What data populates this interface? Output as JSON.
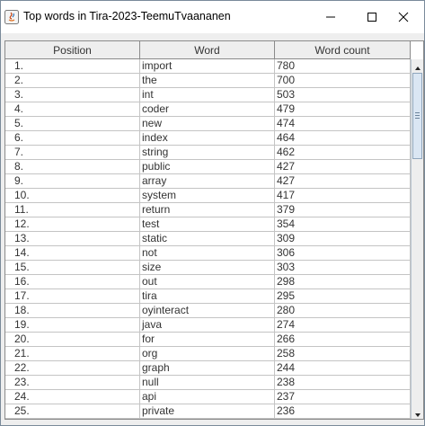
{
  "window": {
    "title": "Top words in Tira-2023-TeemuTvaananen",
    "icon": "java-app-icon",
    "controls": [
      "minimize-icon",
      "maximize-icon",
      "close-icon"
    ]
  },
  "table": {
    "columns": [
      "Position",
      "Word",
      "Word count"
    ],
    "rows": [
      {
        "position": "1.",
        "word": "import",
        "count": "780"
      },
      {
        "position": "2.",
        "word": "the",
        "count": "700"
      },
      {
        "position": "3.",
        "word": "int",
        "count": "503"
      },
      {
        "position": "4.",
        "word": "coder",
        "count": "479"
      },
      {
        "position": "5.",
        "word": "new",
        "count": "474"
      },
      {
        "position": "6.",
        "word": "index",
        "count": "464"
      },
      {
        "position": "7.",
        "word": "string",
        "count": "462"
      },
      {
        "position": "8.",
        "word": "public",
        "count": "427"
      },
      {
        "position": "9.",
        "word": "array",
        "count": "427"
      },
      {
        "position": "10.",
        "word": "system",
        "count": "417"
      },
      {
        "position": "11.",
        "word": "return",
        "count": "379"
      },
      {
        "position": "12.",
        "word": "test",
        "count": "354"
      },
      {
        "position": "13.",
        "word": "static",
        "count": "309"
      },
      {
        "position": "14.",
        "word": "not",
        "count": "306"
      },
      {
        "position": "15.",
        "word": "size",
        "count": "303"
      },
      {
        "position": "16.",
        "word": "out",
        "count": "298"
      },
      {
        "position": "17.",
        "word": "tira",
        "count": "295"
      },
      {
        "position": "18.",
        "word": "oyinteract",
        "count": "280"
      },
      {
        "position": "19.",
        "word": "java",
        "count": "274"
      },
      {
        "position": "20.",
        "word": "for",
        "count": "266"
      },
      {
        "position": "21.",
        "word": "org",
        "count": "258"
      },
      {
        "position": "22.",
        "word": "graph",
        "count": "244"
      },
      {
        "position": "23.",
        "word": "null",
        "count": "238"
      },
      {
        "position": "24.",
        "word": "api",
        "count": "237"
      },
      {
        "position": "25.",
        "word": "private",
        "count": "236"
      }
    ]
  },
  "colors": {
    "accent": "#4d6ea8",
    "grid": "#c4c4c4",
    "header_bg": "#eeeeee",
    "scroll_thumb": "#dae6f3"
  }
}
